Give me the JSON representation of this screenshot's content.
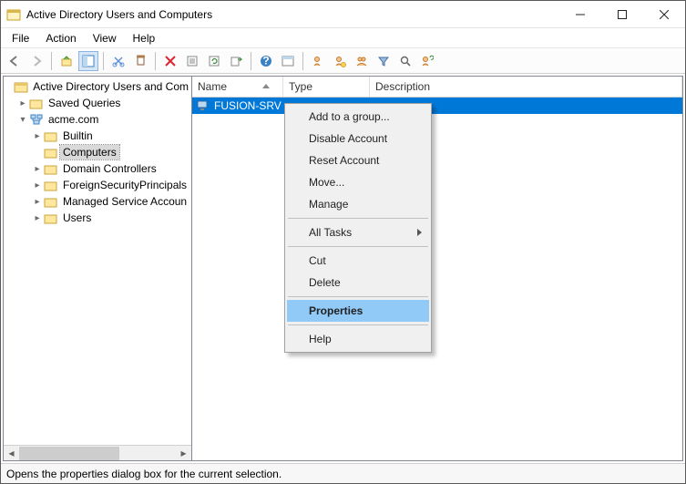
{
  "window": {
    "title": "Active Directory Users and Computers"
  },
  "menu": {
    "file": "File",
    "action": "Action",
    "view": "View",
    "help": "Help"
  },
  "tree": {
    "root": "Active Directory Users and Com",
    "savedQueries": "Saved Queries",
    "domain": "acme.com",
    "nodes": {
      "builtin": "Builtin",
      "computers": "Computers",
      "dcs": "Domain Controllers",
      "fsp": "ForeignSecurityPrincipals",
      "msa": "Managed Service Accoun",
      "users": "Users"
    }
  },
  "list": {
    "cols": {
      "name": "Name",
      "type": "Type",
      "desc": "Description"
    },
    "row": {
      "name": "FUSION-SRV"
    }
  },
  "context": {
    "addGroup": "Add to a group...",
    "disable": "Disable Account",
    "reset": "Reset Account",
    "move": "Move...",
    "manage": "Manage",
    "allTasks": "All Tasks",
    "cut": "Cut",
    "delete": "Delete",
    "properties": "Properties",
    "help": "Help"
  },
  "status": "Opens the properties dialog box for the current selection."
}
